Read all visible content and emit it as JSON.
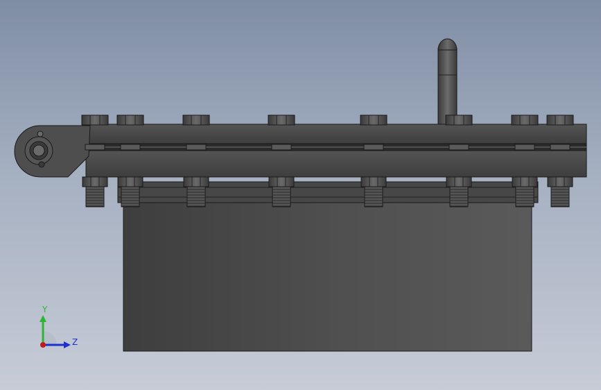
{
  "viewport": {
    "background_top": "#7f8da4",
    "background_bottom": "#c7ccd7"
  },
  "model": {
    "part_color": "#4b4b4b",
    "edge_color": "#1a1a1a"
  },
  "triad": {
    "y_label": "Y",
    "z_label": "Z",
    "y_color": "#2fb535",
    "z_color": "#1e2fd0",
    "x_color": "#c11a1a"
  }
}
